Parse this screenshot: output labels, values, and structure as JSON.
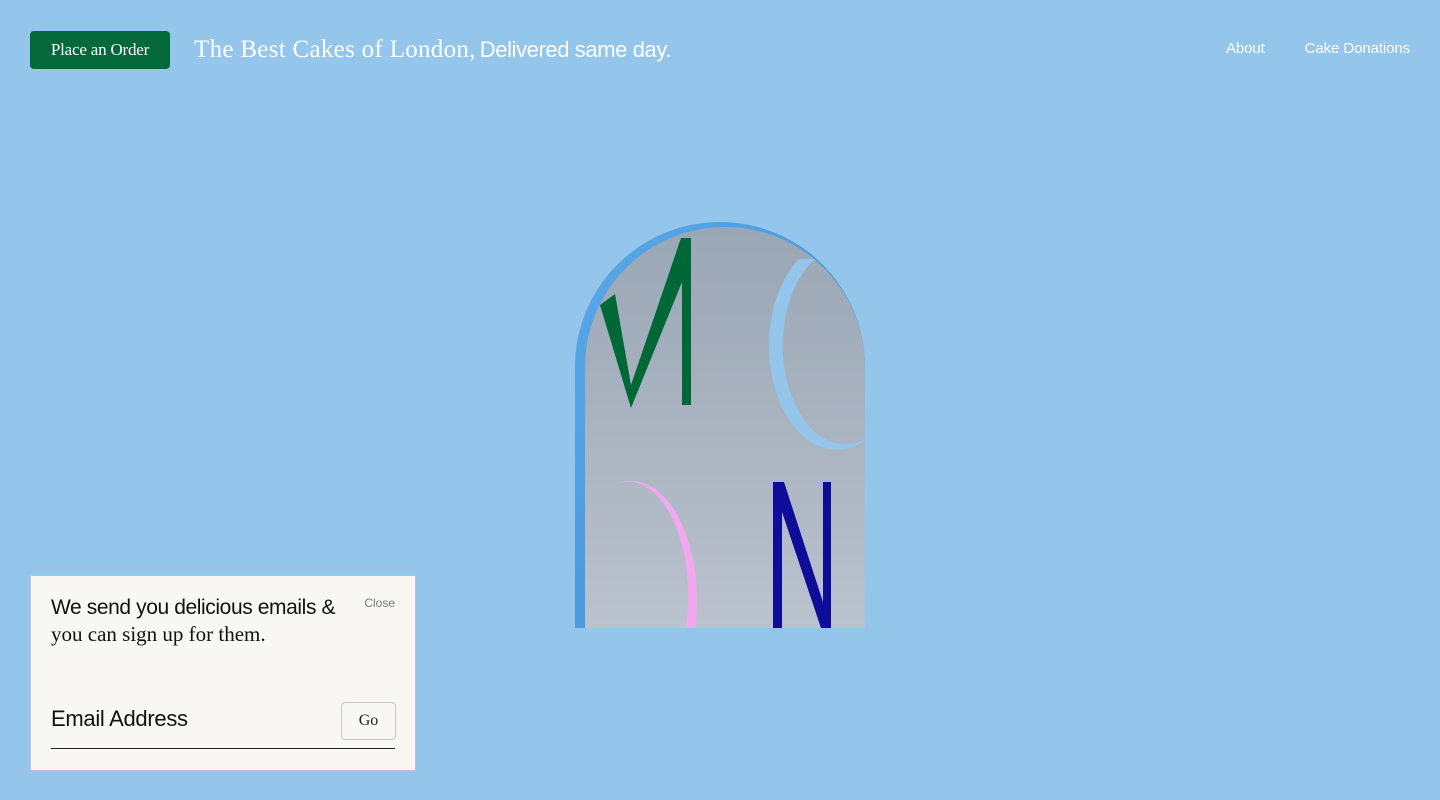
{
  "header": {
    "order_button_label": "Place an Order",
    "tagline_serif": "The Best Cakes of London,",
    "tagline_sans": "Delivered same day."
  },
  "nav": {
    "items": [
      {
        "label": "About"
      },
      {
        "label": "Cake Donations"
      }
    ]
  },
  "logo": {
    "letters": [
      "M",
      "O",
      "O",
      "N"
    ],
    "colors": {
      "m": "#006837",
      "o_top": "#93c6ea",
      "o_bottom": "#f2a8ef",
      "n": "#0d0d9a",
      "frame": "#4a9bdf"
    }
  },
  "newsletter": {
    "heading_sans": "We send you delicious emails &",
    "heading_serif": "you can sign up for them.",
    "close_label": "Close",
    "email_placeholder": "Email Address",
    "submit_label": "Go"
  },
  "colors": {
    "background": "#93c6ea",
    "brand_green": "#03683a",
    "popup_background": "#f8f7f4"
  }
}
